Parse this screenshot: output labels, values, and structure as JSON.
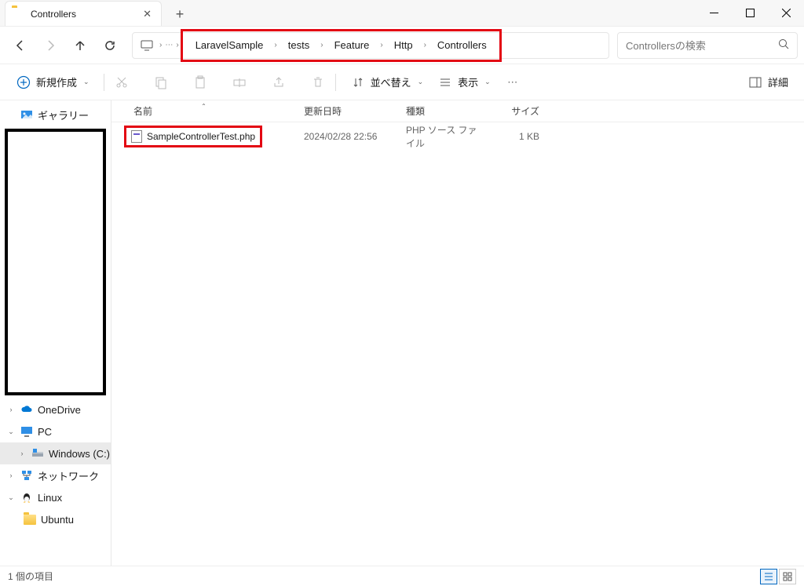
{
  "tab": {
    "title": "Controllers"
  },
  "nav": {
    "back": "←",
    "forward": "→",
    "up": "↑",
    "refresh": "⟳"
  },
  "breadcrumb": [
    "LaravelSample",
    "tests",
    "Feature",
    "Http",
    "Controllers"
  ],
  "search": {
    "placeholder": "Controllersの検索"
  },
  "toolbar": {
    "new": "新規作成",
    "sort": "並べ替え",
    "view": "表示",
    "details": "詳細"
  },
  "headers": {
    "name": "名前",
    "date": "更新日時",
    "type": "種類",
    "size": "サイズ"
  },
  "file": {
    "name": "SampleControllerTest.php",
    "date": "2024/02/28 22:56",
    "type": "PHP ソース ファイル",
    "size": "1 KB"
  },
  "sidebar": {
    "gallery": "ギャラリー",
    "onedrive": "OneDrive",
    "pc": "PC",
    "windows": "Windows (C:)",
    "network": "ネットワーク",
    "linux": "Linux",
    "ubuntu": "Ubuntu"
  },
  "status": {
    "count": "1 個の項目"
  }
}
